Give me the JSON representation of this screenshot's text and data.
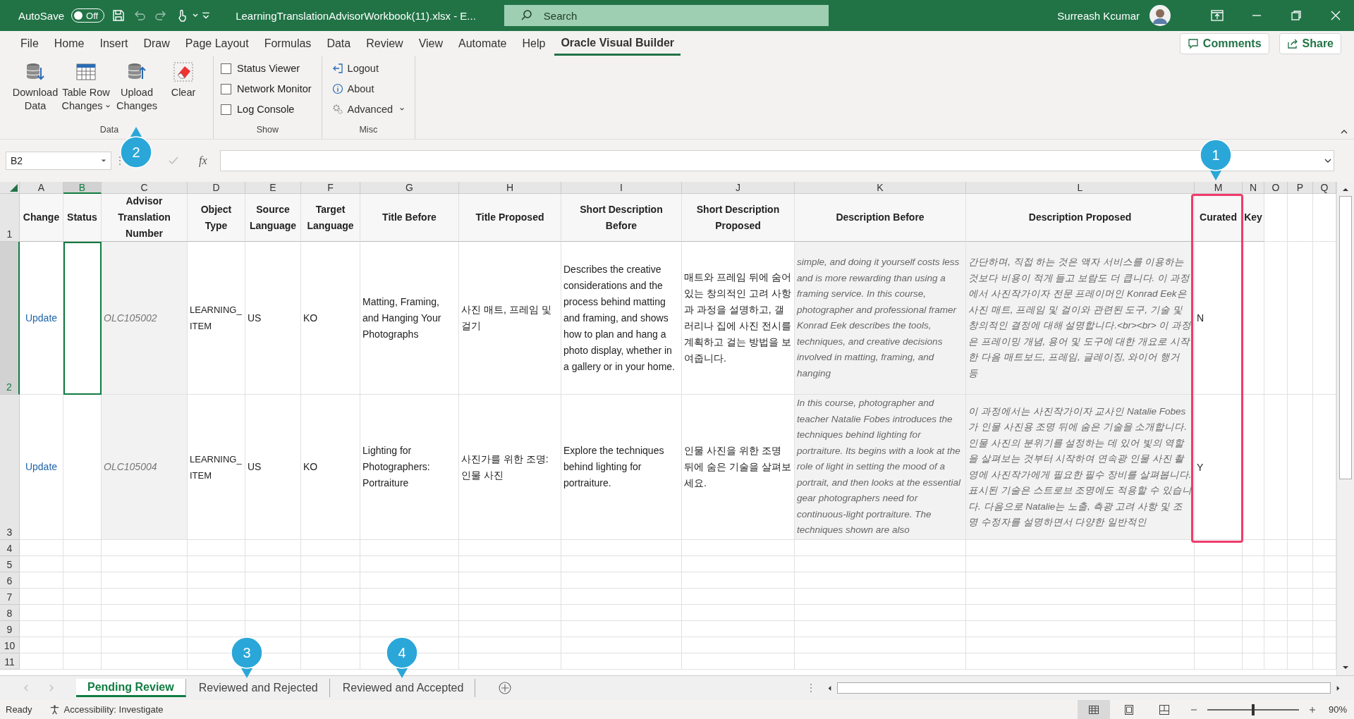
{
  "title_bar": {
    "autosave_label": "AutoSave",
    "autosave_on": false,
    "autosave_state": "Off",
    "file_name": "LearningTranslationAdvisorWorkbook(11).xlsx  -  E...",
    "search_placeholder": "Search",
    "user_name": "Surreash Kcumar"
  },
  "menu_tabs": [
    {
      "label": "File",
      "selected": false
    },
    {
      "label": "Home",
      "selected": false
    },
    {
      "label": "Insert",
      "selected": false
    },
    {
      "label": "Draw",
      "selected": false
    },
    {
      "label": "Page Layout",
      "selected": false
    },
    {
      "label": "Formulas",
      "selected": false
    },
    {
      "label": "Data",
      "selected": false
    },
    {
      "label": "Review",
      "selected": false
    },
    {
      "label": "View",
      "selected": false
    },
    {
      "label": "Automate",
      "selected": false
    },
    {
      "label": "Help",
      "selected": false
    },
    {
      "label": "Oracle Visual Builder",
      "selected": true
    }
  ],
  "header_buttons": [
    "Comments",
    "Share"
  ],
  "ribbon_groups": [
    {
      "label": "Data",
      "kind": "buttons",
      "items": [
        {
          "label": "Download Data",
          "dropdown": false
        },
        {
          "label": "Table Row Changes",
          "dropdown": true
        },
        {
          "label": "Upload Changes",
          "dropdown": false
        },
        {
          "label": "Clear",
          "dropdown": false
        }
      ]
    },
    {
      "label": "Show",
      "kind": "checkboxes",
      "items": [
        {
          "label": "Status Viewer",
          "checked": false
        },
        {
          "label": "Network Monitor",
          "checked": false
        },
        {
          "label": "Log Console",
          "checked": false
        }
      ]
    },
    {
      "label": "Misc",
      "kind": "links",
      "items": [
        {
          "label": "Logout",
          "dropdown": false
        },
        {
          "label": "About",
          "dropdown": false
        },
        {
          "label": "Advanced",
          "dropdown": true
        }
      ]
    }
  ],
  "formula_bar": {
    "name_box": "B2",
    "function_label": "fx"
  },
  "sheet": {
    "columns": [
      {
        "letter": "A",
        "selected": false
      },
      {
        "letter": "B",
        "selected": true
      },
      {
        "letter": "C",
        "selected": false
      },
      {
        "letter": "D",
        "selected": false
      },
      {
        "letter": "E",
        "selected": false
      },
      {
        "letter": "F",
        "selected": false
      },
      {
        "letter": "G",
        "selected": false
      },
      {
        "letter": "H",
        "selected": false
      },
      {
        "letter": "I",
        "selected": false
      },
      {
        "letter": "J",
        "selected": false
      },
      {
        "letter": "K",
        "selected": false
      },
      {
        "letter": "L",
        "selected": false
      },
      {
        "letter": "M",
        "selected": false
      },
      {
        "letter": "N",
        "selected": false
      },
      {
        "letter": "O",
        "selected": false
      },
      {
        "letter": "P",
        "selected": false
      },
      {
        "letter": "Q",
        "selected": false
      }
    ],
    "row_numbers": [
      {
        "label": "1",
        "selected": false
      },
      {
        "label": "2",
        "selected": true
      },
      {
        "label": "3",
        "selected": false
      },
      {
        "label": "4",
        "selected": false
      },
      {
        "label": "5",
        "selected": false
      },
      {
        "label": "6",
        "selected": false
      },
      {
        "label": "7",
        "selected": false
      },
      {
        "label": "8",
        "selected": false
      },
      {
        "label": "9",
        "selected": false
      },
      {
        "label": "10",
        "selected": false
      },
      {
        "label": "11",
        "selected": false
      }
    ],
    "headers": [
      "Change",
      "Status",
      "Advisor Translation Number",
      "Object Type",
      "Source Language",
      "Target Language",
      "Title Before",
      "Title Proposed",
      "Short Description Before",
      "Short Description Proposed",
      "Description Before",
      "Description Proposed",
      "Curated",
      "Key"
    ],
    "rows": [
      {
        "status_selected": true,
        "change": "Update",
        "advisor_translation_number": "OLC105002",
        "object_type": "LEARNING_ITEM",
        "source_language": "US",
        "target_language": "KO",
        "title_before": "Matting, Framing, and Hanging Your Photographs",
        "title_proposed": "사진 매트, 프레임 및 걸기",
        "short_description_before": "Describes the creative considerations and the process behind matting and framing, and shows how to plan and hang a photo display, whether in a gallery or in your home.",
        "short_description_proposed": "매트와 프레임 뒤에 숨어 있는 창의적인 고려 사항과 과정을 설명하고, 갤러리나 집에 사진 전시를 계획하고 걸는 방법을 보여줍니다.",
        "description_before": "simple, and doing it yourself costs less and is more rewarding than using a framing service. In this course, photographer and professional framer Konrad Eek describes the tools, techniques, and creative decisions involved in matting, framing, and hanging",
        "description_proposed": "간단하며, 직접 하는 것은 액자 서비스를 이용하는 것보다 비용이 적게 들고 보람도 더 큽니다. 이 과정에서 사진작가이자 전문 프레이머인 Konrad Eek은 사진 매트, 프레임 및 걸이와 관련된 도구, 기술 및 창의적인 결정에 대해 설명합니다.<br><br> 이 과정은 프레이밍 개념, 용어 및 도구에 대한 개요로 시작한 다음 매트보드, 프레임, 글레이징, 와이어 행거 등",
        "curated": "N"
      },
      {
        "status_selected": false,
        "change": "Update",
        "advisor_translation_number": "OLC105004",
        "object_type": "LEARNING_ITEM",
        "source_language": "US",
        "target_language": "KO",
        "title_before": "Lighting for Photographers: Portraiture",
        "title_proposed": "사진가를 위한 조명: 인물 사진",
        "short_description_before": "Explore the techniques behind lighting for portraiture.",
        "short_description_proposed": "인물 사진을 위한 조명 뒤에 숨은 기술을 살펴보세요.",
        "description_before": "In this course, photographer and teacher Natalie Fobes introduces the techniques behind lighting for portraiture. Its begins with a look at the role of light in setting the mood of a portrait, and then looks at the essential gear photographers need for continuous-light portraiture. The techniques shown are also",
        "description_proposed": "이 과정에서는 사진작가이자 교사인 Natalie Fobes가 인물 사진용 조명 뒤에 숨은 기술을 소개합니다. 인물 사진의 분위기를 설정하는 데 있어 빛의 역할을 살펴보는 것부터 시작하여 연속광 인물 사진 촬영에 사진작가에게 필요한 필수 장비를 살펴봅니다. 표시된 기술은 스트로브 조명에도 적용할 수 있습니다. 다음으로 Natalie는 노출, 측광 고려 사항 및 조명 수정자를 설명하면서 다양한 일반적인",
        "curated": "Y"
      }
    ]
  },
  "sheet_tabs": [
    {
      "label": "Pending Review",
      "selected": true
    },
    {
      "label": "Reviewed and Rejected",
      "selected": false
    },
    {
      "label": "Reviewed and Accepted",
      "selected": false
    }
  ],
  "status_bar": {
    "ready": "Ready",
    "accessibility": "Accessibility: Investigate",
    "views": [
      {
        "kind": "normal",
        "selected": true
      },
      {
        "kind": "page_layout",
        "selected": false
      },
      {
        "kind": "page_break",
        "selected": false
      }
    ],
    "zoom_slider": {
      "level": 0.5
    },
    "zoom": "90%"
  },
  "callouts": [
    {
      "label": "1"
    },
    {
      "label": "2"
    },
    {
      "label": "3"
    },
    {
      "label": "4"
    }
  ]
}
